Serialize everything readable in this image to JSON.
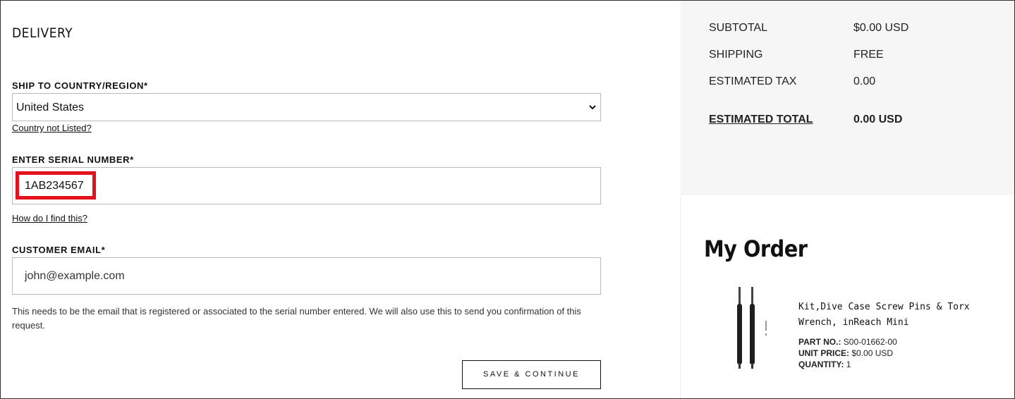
{
  "delivery": {
    "heading": "DELIVERY",
    "country_label": "SHIP TO COUNTRY/REGION*",
    "country_value": "United States",
    "country_link": "Country not Listed?",
    "serial_label": "ENTER SERIAL NUMBER*",
    "serial_value": "1AB234567",
    "serial_link": "How do I find this?",
    "email_label": "CUSTOMER EMAIL*",
    "email_value": "john@example.com",
    "email_helper": "This needs to be the email that is registered or associated to the serial number entered. We will also use this to send you confirmation of this request.",
    "save_button": "SAVE & CONTINUE"
  },
  "summary": {
    "subtotal_label": "SUBTOTAL",
    "subtotal_value": "$0.00 USD",
    "shipping_label": "SHIPPING",
    "shipping_value": "FREE",
    "tax_label": "ESTIMATED TAX",
    "tax_value": "0.00",
    "total_label": "ESTIMATED TOTAL",
    "total_value": "0.00 USD"
  },
  "order": {
    "title": "My Order",
    "product_name": "Kit,Dive Case Screw Pins & Torx Wrench, inReach Mini",
    "part_no_label": "PART NO.:",
    "part_no_value": "S00-01662-00",
    "unit_price_label": "UNIT PRICE:",
    "unit_price_value": "$0.00 USD",
    "quantity_label": "QUANTITY:",
    "quantity_value": "1"
  },
  "colors": {
    "highlight": "#e2111b",
    "summary_bg": "#f6f6f6"
  },
  "icons": {
    "select_chevron": "chevron-down-icon",
    "product_image": "screwdriver-kit-image"
  }
}
